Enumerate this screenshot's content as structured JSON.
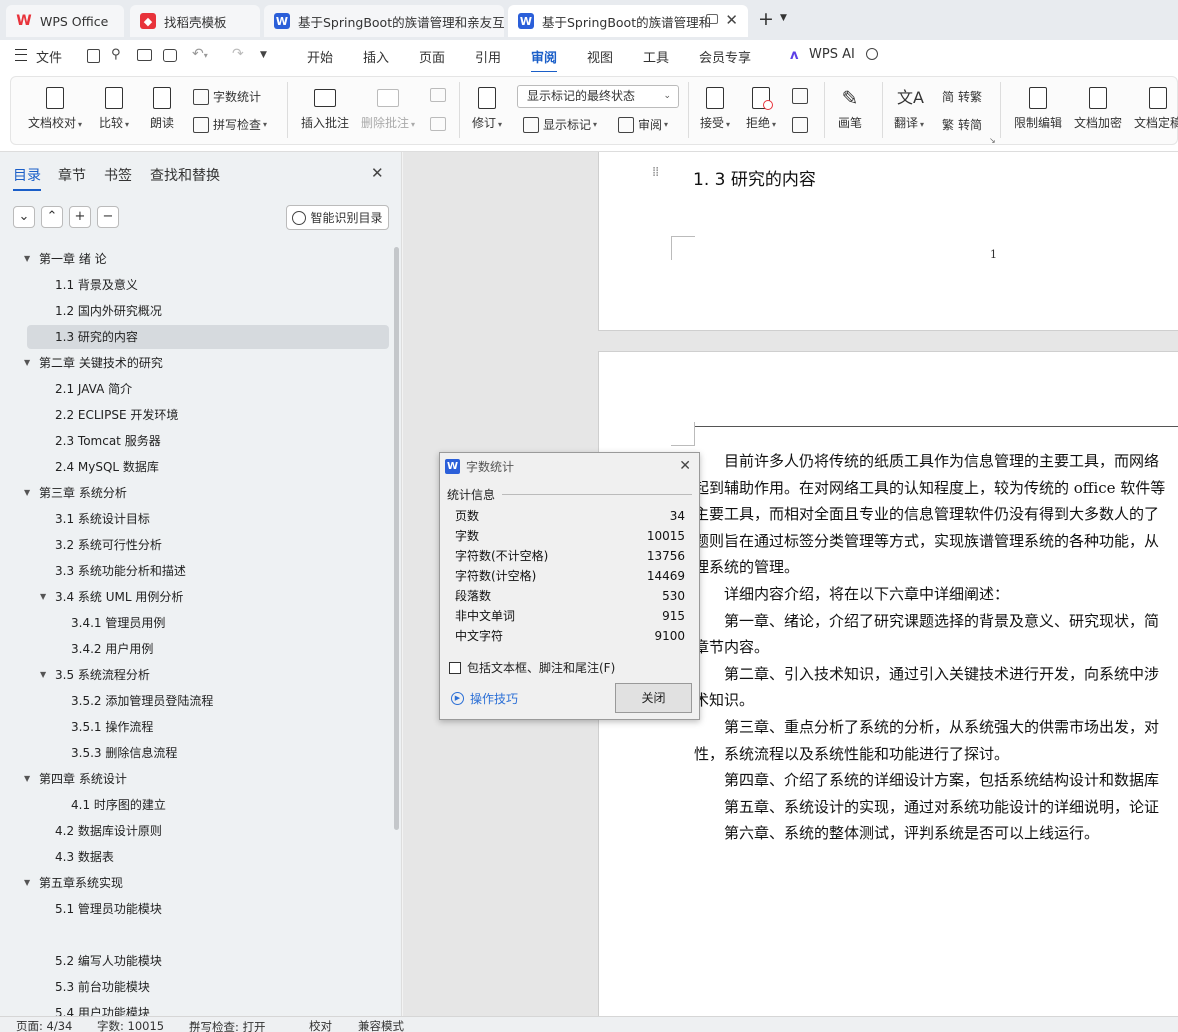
{
  "tabs": [
    {
      "label": "WPS Office",
      "icon": "wps-logo-icon"
    },
    {
      "label": "找稻壳模板",
      "icon": "daoke-icon"
    },
    {
      "label": "基于SpringBoot的族谱管理和亲友互",
      "icon": "word-doc-icon"
    },
    {
      "label": "基于SpringBoot的族谱管理和",
      "icon": "word-doc-icon"
    }
  ],
  "menubar": {
    "file": "文件",
    "items": [
      "开始",
      "插入",
      "页面",
      "引用",
      "审阅",
      "视图",
      "工具",
      "会员专享"
    ],
    "active": "审阅",
    "ai": "WPS AI"
  },
  "ribbon": {
    "doc_check": "文档校对",
    "compare": "比较",
    "read_aloud": "朗读",
    "word_count": "字数统计",
    "spell_check": "拼写检查",
    "insert_comment": "插入批注",
    "delete_comment": "删除批注",
    "revise": "修订",
    "display_state": "显示标记的最终状态",
    "show_markup": "显示标记",
    "review_pane": "审阅",
    "accept": "接受",
    "reject": "拒绝",
    "pen": "画笔",
    "translate": "翻译",
    "to_traditional": "转繁",
    "to_simplified": "转简",
    "restrict_edit": "限制编辑",
    "encrypt": "文档加密",
    "finalize": "文档定稿"
  },
  "nav": {
    "tabs": [
      "目录",
      "章节",
      "书签",
      "查找和替换"
    ],
    "smart_toc": "智能识别目录",
    "items": [
      {
        "label": "第一章  绪  论",
        "level": 1,
        "expanded": true
      },
      {
        "label": "1.1 背景及意义",
        "level": 2
      },
      {
        "label": "1.2 国内外研究概况",
        "level": 2
      },
      {
        "label": "1.3  研究的内容",
        "level": 2,
        "selected": true
      },
      {
        "label": "第二章  关键技术的研究",
        "level": 1,
        "expanded": true
      },
      {
        "label": "2.1 JAVA 简介",
        "level": 2
      },
      {
        "label": "2.2 ECLIPSE  开发环境",
        "level": 2
      },
      {
        "label": "2.3 Tomcat 服务器",
        "level": 2
      },
      {
        "label": "2.4 MySQL 数据库",
        "level": 2
      },
      {
        "label": "第三章  系统分析",
        "level": 1,
        "expanded": true
      },
      {
        "label": "3.1  系统设计目标",
        "level": 2
      },
      {
        "label": "3.2  系统可行性分析",
        "level": 2
      },
      {
        "label": "3.3  系统功能分析和描述",
        "level": 2
      },
      {
        "label": "3.4 系统 UML 用例分析",
        "level": 2,
        "expanded": true
      },
      {
        "label": "3.4.1 管理员用例",
        "level": 3
      },
      {
        "label": "3.4.2 用户用例",
        "level": 3
      },
      {
        "label": "3.5 系统流程分析",
        "level": 2,
        "expanded": true
      },
      {
        "label": "3.5.2 添加管理员登陆流程",
        "level": 3
      },
      {
        "label": "3.5.1 操作流程",
        "level": 3
      },
      {
        "label": "3.5.3 删除信息流程",
        "level": 3
      },
      {
        "label": "第四章  系统设计",
        "level": 1,
        "expanded": true
      },
      {
        "label": "4.1  时序图的建立",
        "level": 3
      },
      {
        "label": "4.2  数据库设计原则",
        "level": 2
      },
      {
        "label": "4.3  数据表",
        "level": 2
      },
      {
        "label": "第五章系统实现",
        "level": 1,
        "expanded": true
      },
      {
        "label": "5.1 管理员功能模块",
        "level": 2
      },
      {
        "label": "5.2 编写人功能模块",
        "level": 2
      },
      {
        "label": "5.3 前台功能模块",
        "level": 2
      },
      {
        "label": "5.4 用户功能模块",
        "level": 2
      }
    ]
  },
  "document": {
    "heading": "1. 3  研究的内容",
    "page_number": "1",
    "lines": [
      "　　目前许多人仍将传统的纸质工具作为信息管理的主要工具，而网络",
      "起到辅助作用。在对网络工具的认知程度上，较为传统的 office 软件等",
      "主要工具，而相对全面且专业的信息管理软件仍没有得到大多数人的了",
      "题则旨在通过标签分类管理等方式，实现族谱管理系统的各种功能，从",
      "理系统的管理。",
      "　　详细内容介绍，将在以下六章中详细阐述：",
      "　　第一章、绪论，介绍了研究课题选择的背景及意义、研究现状，简",
      "章节内容。",
      "　　第二章、引入技术知识，通过引入关键技术进行开发，向系统中涉",
      "术知识。",
      "　　第三章、重点分析了系统的分析，从系统强大的供需市场出发，对",
      "性，系统流程以及系统性能和功能进行了探讨。",
      "　　第四章、介绍了系统的详细设计方案，包括系统结构设计和数据库",
      "　　第五章、系统设计的实现，通过对系统功能设计的详细说明，论证",
      "　　第六章、系统的整体测试，评判系统是否可以上线运行。"
    ]
  },
  "word_count_dialog": {
    "title": "字数统计",
    "section": "统计信息",
    "stats": [
      {
        "label": "页数",
        "value": "34"
      },
      {
        "label": "字数",
        "value": "10015"
      },
      {
        "label": "字符数(不计空格)",
        "value": "13756"
      },
      {
        "label": "字符数(计空格)",
        "value": "14469"
      },
      {
        "label": "段落数",
        "value": "530"
      },
      {
        "label": "非中文单词",
        "value": "915"
      },
      {
        "label": "中文字符",
        "value": "9100"
      }
    ],
    "checkbox_label": "包括文本框、脚注和尾注(F)",
    "checkbox_checked": false,
    "tips_link": "操作技巧",
    "close_button": "关闭"
  },
  "statusbar": {
    "page": "页面: 4/34",
    "words": "字数: 10015",
    "spell": "拼写检查: 打开",
    "proof": "校对",
    "compat": "兼容模式"
  },
  "colors": {
    "accent": "#1a5ec8",
    "wps_red": "#e8333b",
    "word_blue": "#2b5fd9"
  }
}
